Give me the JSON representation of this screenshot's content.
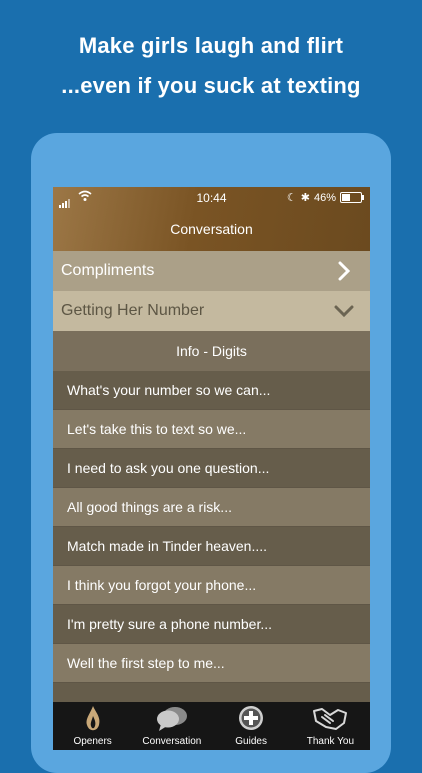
{
  "promo": {
    "line1": "Make girls laugh and flirt",
    "line2": "...even if you suck at texting"
  },
  "status_bar": {
    "time": "10:44",
    "battery": "46%",
    "battery_level": 0.46
  },
  "nav": {
    "title": "Conversation"
  },
  "categories": [
    {
      "label": "Compliments",
      "state": "collapsed"
    },
    {
      "label": "Getting Her Number",
      "state": "expanded"
    }
  ],
  "subheader": "Info - Digits",
  "items": [
    "What's your number so we can...",
    "Let's take this to text so we...",
    "I need to ask you one question...",
    "All good things are a risk...",
    "Match made in Tinder heaven....",
    "I think you forgot your phone...",
    "I'm pretty sure a phone number...",
    "Well the first step to me..."
  ],
  "tabs": [
    {
      "label": "Openers",
      "icon": "flame-icon"
    },
    {
      "label": "Conversation",
      "icon": "chat-bubbles-icon"
    },
    {
      "label": "Guides",
      "icon": "plus-circle-icon"
    },
    {
      "label": "Thank You",
      "icon": "handshake-icon"
    }
  ],
  "colors": {
    "background": "#1a6fae",
    "frame": "#5aa6df",
    "nav": "#7a5424",
    "tabbar": "#161616"
  }
}
